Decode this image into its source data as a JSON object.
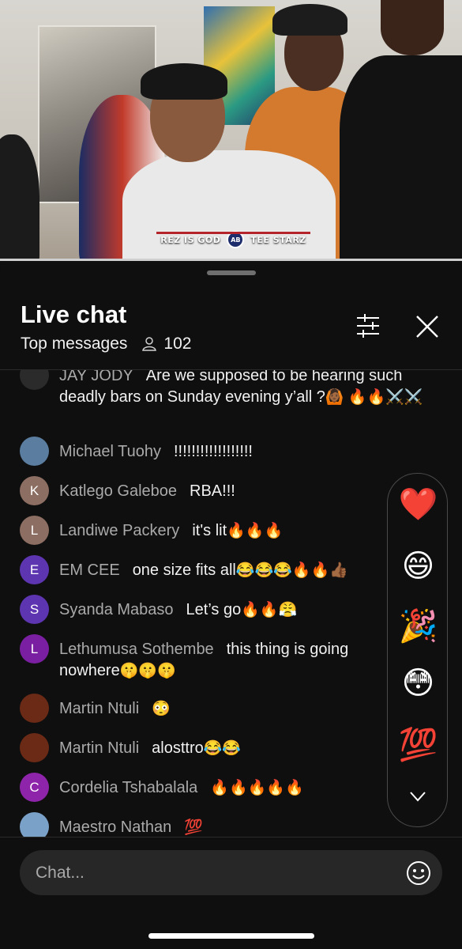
{
  "video": {
    "banner_left": "REZ IS GOD",
    "banner_right": "TEE STARZ",
    "banner_logo": "AB",
    "progress_fraction": 1.0
  },
  "header": {
    "title": "Live chat",
    "mode": "Top messages",
    "viewer_count": "102",
    "filter_icon": "sliders-icon",
    "close_icon": "close-icon"
  },
  "messages": [
    {
      "author": "JAY JODY",
      "text": "Are we supposed to be hearing such deadly bars on Sunday evening y’all ?",
      "emoji": "🙆🏾 🔥🔥⚔️⚔️",
      "avatar_letter": "",
      "avatar_color": "#2b2b2b"
    },
    {
      "author": "Michael Tuohy",
      "text": "!!!!!!!!!!!!!!!!!!",
      "emoji": "",
      "avatar_letter": "",
      "avatar_color": "#5a7da0"
    },
    {
      "author": "Katlego Galeboe",
      "text": "RBA!!!",
      "emoji": "",
      "avatar_letter": "K",
      "avatar_color": "#8d6e63"
    },
    {
      "author": "Landiwe Packery",
      "text": "it's lit",
      "emoji": "🔥🔥🔥",
      "avatar_letter": "L",
      "avatar_color": "#8d6e63"
    },
    {
      "author": "EM CEE",
      "text": "one size fits all",
      "emoji": "😂😂😂🔥🔥👍🏾",
      "avatar_letter": "E",
      "avatar_color": "#5e35b1"
    },
    {
      "author": "Syanda Mabaso",
      "text": "Let’s go",
      "emoji": "🔥🔥😤",
      "avatar_letter": "S",
      "avatar_color": "#5e35b1"
    },
    {
      "author": "Lethumusa Sothembe",
      "text": "this thing is going nowhere",
      "emoji": "🤫🤫🤫",
      "avatar_letter": "L",
      "avatar_color": "#7b1fa2"
    },
    {
      "author": "Martin Ntuli",
      "text": "",
      "emoji": "😳",
      "avatar_letter": "",
      "avatar_color": "#6b2a16"
    },
    {
      "author": "Martin Ntuli",
      "text": "alosttro",
      "emoji": "😂😂",
      "avatar_letter": "",
      "avatar_color": "#6b2a16"
    },
    {
      "author": "Cordelia Tshabalala",
      "text": "",
      "emoji": "🔥🔥🔥🔥🔥",
      "avatar_letter": "C",
      "avatar_color": "#8e24aa"
    },
    {
      "author": "Maestro Nathan",
      "text": "",
      "emoji": "💯",
      "avatar_letter": "",
      "avatar_color": "#7aa1c8"
    }
  ],
  "reactions": {
    "items": [
      {
        "icon": "heart-icon",
        "glyph": "❤️"
      },
      {
        "icon": "grinning-face-icon",
        "glyph": "😄"
      },
      {
        "icon": "party-popper-icon",
        "glyph": "🎉"
      },
      {
        "icon": "flushed-face-icon",
        "glyph": "😳"
      },
      {
        "icon": "hundred-points-icon",
        "glyph": "💯"
      }
    ],
    "expand_icon": "chevron-down-icon"
  },
  "composer": {
    "placeholder": "Chat...",
    "emoji_icon": "smiley-icon"
  }
}
